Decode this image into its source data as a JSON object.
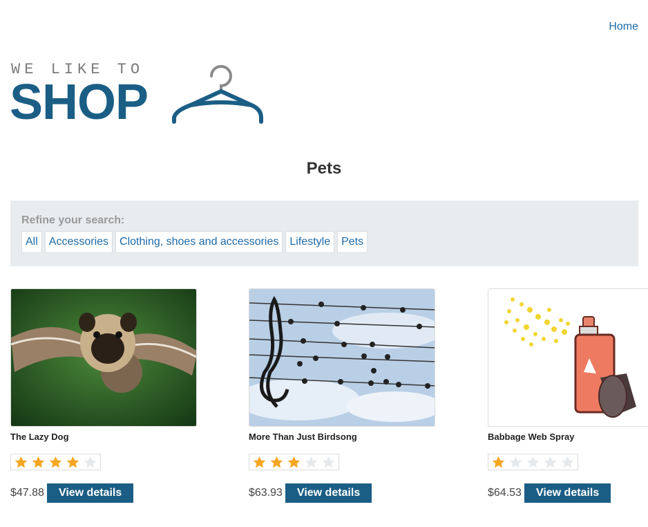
{
  "nav": {
    "home_label": "Home"
  },
  "logo": {
    "small_text": "WE LIKE TO",
    "big_text": "SHOP"
  },
  "page": {
    "title": "Pets"
  },
  "filter": {
    "label": "Refine your search:",
    "links": [
      "All",
      "Accessories",
      "Clothing, shoes and accessories",
      "Lifestyle",
      "Pets"
    ]
  },
  "colors": {
    "accent": "#1b5e85",
    "link": "#1c6aa8",
    "star": "#f5a623",
    "filter_bg": "#e9ecef"
  },
  "products": [
    {
      "name": "The Lazy Dog",
      "rating": 4,
      "rating_max": 5,
      "price": "$47.88",
      "button": "View details",
      "image": "flying-pug-image"
    },
    {
      "name": "More Than Just Birdsong",
      "rating": 3,
      "rating_max": 5,
      "price": "$63.93",
      "button": "View details",
      "image": "birds-on-wires-music-image"
    },
    {
      "name": "Babbage Web Spray",
      "rating": 1,
      "rating_max": 5,
      "price": "$64.53",
      "button": "View details",
      "image": "spray-can-image"
    }
  ]
}
